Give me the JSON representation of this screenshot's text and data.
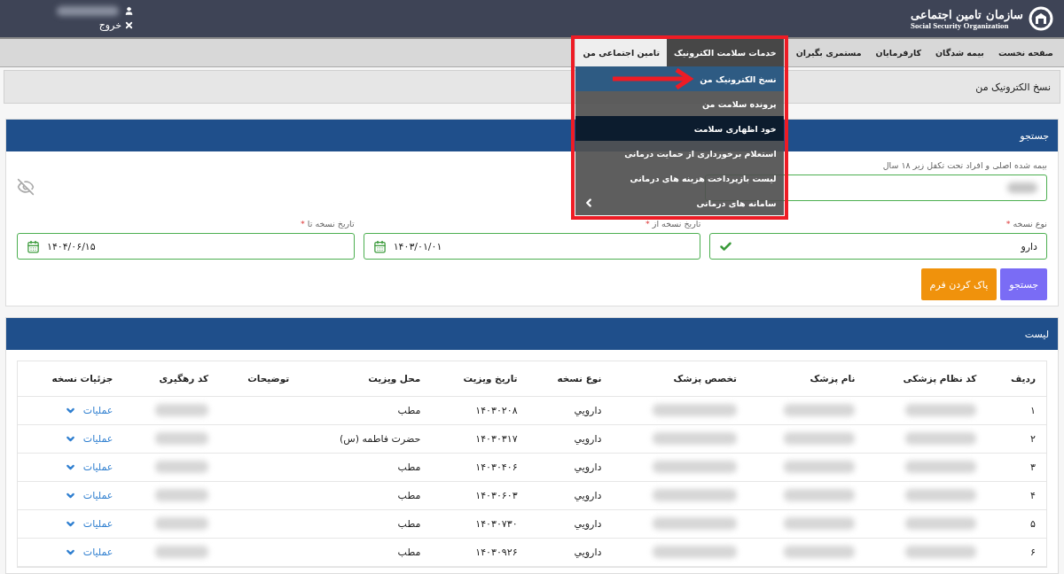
{
  "header": {
    "logo_title": "سازمان تامین اجتماعی",
    "logo_subtitle": "Social Security Organization",
    "logout": "خروج",
    "user_blurred": true
  },
  "nav": [
    {
      "label": "صفحه نخست",
      "selected": false,
      "highlighted": false
    },
    {
      "label": "بیمه شدگان",
      "selected": false,
      "highlighted": false
    },
    {
      "label": "کارفرمایان",
      "selected": false,
      "highlighted": false
    },
    {
      "label": "مستمری بگیران",
      "selected": false,
      "highlighted": false
    },
    {
      "label": "خدمات سلامت الکترونیک",
      "selected": true,
      "highlighted": false
    },
    {
      "label": "تامین اجتماعی من",
      "selected": false,
      "highlighted": true
    }
  ],
  "menu": [
    {
      "label": "نسخ الکترونیک من",
      "selected": true,
      "highlighted": false,
      "has_submenu": false
    },
    {
      "label": "پرونده سلامت من",
      "selected": false,
      "highlighted": false,
      "has_submenu": false
    },
    {
      "label": "خود اظهاری سلامت",
      "selected": false,
      "highlighted": true,
      "has_submenu": false
    },
    {
      "label": "استعلام برخورداری از حمایت درمانی",
      "selected": false,
      "highlighted": false,
      "has_submenu": false
    },
    {
      "label": "لیست بازپرداخت هزینه های درمانی",
      "selected": false,
      "highlighted": false,
      "has_submenu": false
    },
    {
      "label": "سامانه های درمانی",
      "selected": false,
      "highlighted": false,
      "has_submenu": true
    }
  ],
  "breadcrumb": "نسخ الکترونیک من",
  "search_panel": {
    "title": "جستجو",
    "insured_label": "بیمه شده اصلی و افراد تحت تکفل زیر ۱۸ سال",
    "fields": [
      {
        "label": "نوع نسخه",
        "required_mark": "*",
        "value": "دارو",
        "kind": "select"
      },
      {
        "label": "تاریخ نسخه از",
        "required_mark": "*",
        "value": "۱۴۰۳/۰۱/۰۱",
        "kind": "date"
      },
      {
        "label": "تاریخ نسخه تا",
        "required_mark": "*",
        "value": "۱۴۰۴/۰۶/۱۵",
        "kind": "date"
      }
    ],
    "buttons": [
      {
        "label": "جستجو",
        "kind": "primary"
      },
      {
        "label": "پاک کردن فرم",
        "kind": "warning"
      }
    ]
  },
  "list_panel": {
    "title": "لیست",
    "columns": [
      {
        "label": "ردیف",
        "blurred": false,
        "kind": "index"
      },
      {
        "label": "کد نظام پزشکی",
        "blurred": true
      },
      {
        "label": "نام پزشک",
        "blurred": true
      },
      {
        "label": "تخصص پزشک",
        "blurred": true
      },
      {
        "label": "نوع نسخه",
        "blurred": false,
        "kind": "type"
      },
      {
        "label": "تاریخ ویزیت",
        "blurred": false,
        "kind": "visit_date"
      },
      {
        "label": "محل ویزیت",
        "blurred": false,
        "kind": "visit_place"
      },
      {
        "label": "توضیحات",
        "blurred": false,
        "kind": "text"
      },
      {
        "label": "کد رهگیری",
        "blurred": true
      },
      {
        "label": "جزئیات نسخه",
        "blurred": false,
        "kind": "action"
      }
    ],
    "rows": [
      {
        "index": "۱",
        "type": "دارويي",
        "visit_date": "۱۴۰۳۰۲۰۸",
        "visit_place": "مطب",
        "action": "عملیات"
      },
      {
        "index": "۲",
        "type": "دارويي",
        "visit_date": "۱۴۰۳۰۳۱۷",
        "visit_place": "حضرت فاطمه (س)",
        "action": "عملیات"
      },
      {
        "index": "۳",
        "type": "دارويي",
        "visit_date": "۱۴۰۳۰۴۰۶",
        "visit_place": "مطب",
        "action": "عملیات"
      },
      {
        "index": "۴",
        "type": "دارويي",
        "visit_date": "۱۴۰۳۰۶۰۳",
        "visit_place": "مطب",
        "action": "عملیات"
      },
      {
        "index": "۵",
        "type": "دارويي",
        "visit_date": "۱۴۰۳۰۷۳۰",
        "visit_place": "مطب",
        "action": "عملیات"
      },
      {
        "index": "۶",
        "type": "دارويي",
        "visit_date": "۱۴۰۳۰۹۲۶",
        "visit_place": "مطب",
        "action": "عملیات"
      }
    ]
  }
}
